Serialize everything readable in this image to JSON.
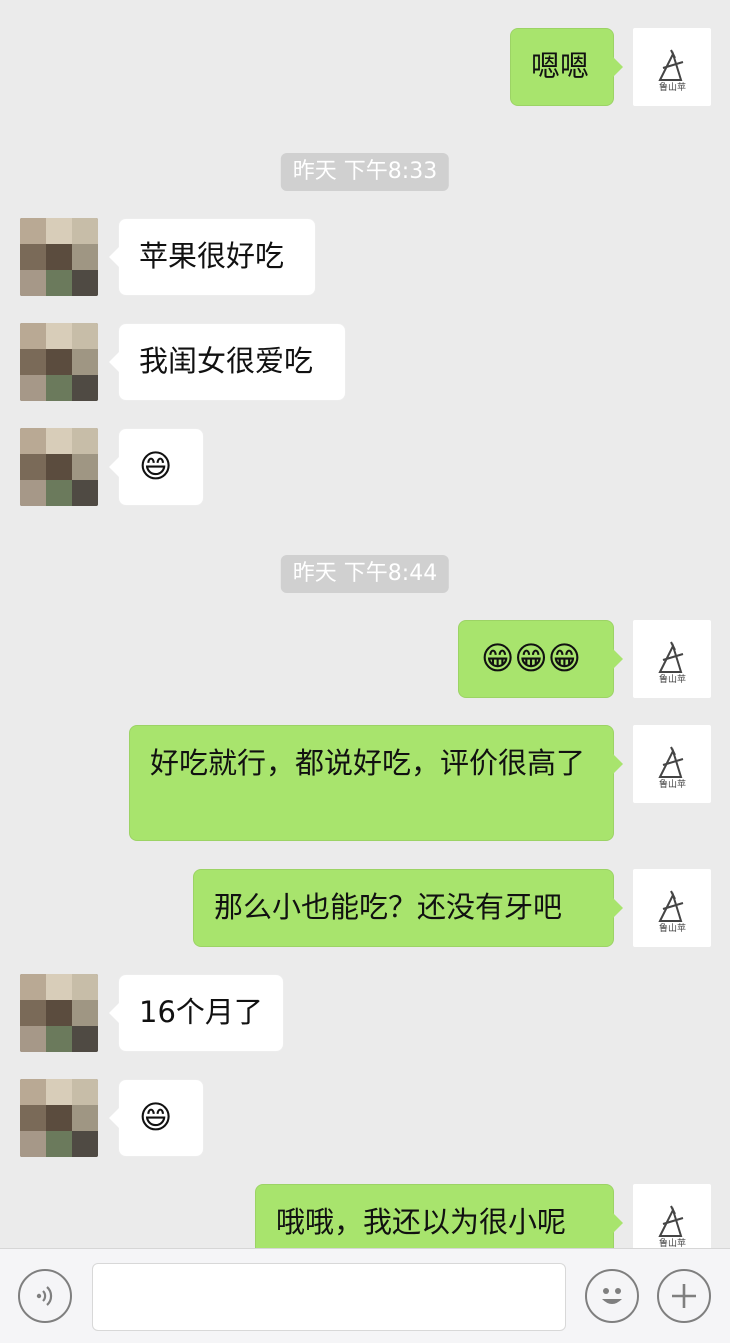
{
  "conversation": {
    "messages": [
      {
        "sender": "me",
        "text": "嗯嗯"
      },
      {
        "timestamp": "昨天 下午8:33"
      },
      {
        "sender": "them",
        "text": "苹果很好吃"
      },
      {
        "sender": "them",
        "text": "我闺女很爱吃"
      },
      {
        "sender": "them",
        "text": "😄"
      },
      {
        "timestamp": "昨天 下午8:44"
      },
      {
        "sender": "me",
        "text": "😁😁😁"
      },
      {
        "sender": "me",
        "text": "好吃就行，都说好吃，评价很高了"
      },
      {
        "sender": "me",
        "text": "那么小也能吃？还没有牙吧"
      },
      {
        "sender": "them",
        "text": "16个月了"
      },
      {
        "sender": "them",
        "text": "😄"
      },
      {
        "sender": "me",
        "text": "哦哦，我还以为很小呢"
      }
    ]
  },
  "input_bar": {
    "voice_icon": "voice-icon",
    "emoji_icon": "emoji-icon",
    "plus_icon": "plus-icon",
    "text_value": ""
  },
  "colors": {
    "background": "#ebebeb",
    "my_bubble": "#a8e46d",
    "their_bubble": "#ffffff",
    "timestamp_bg": "#d0d0d0"
  }
}
